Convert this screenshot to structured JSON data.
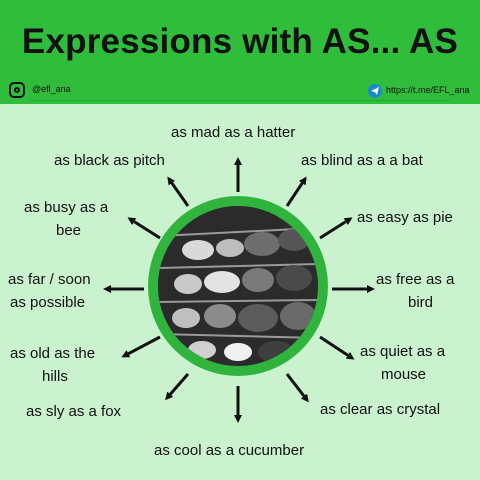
{
  "header": {
    "title": "Expressions with AS... AS",
    "instagram_handle": "@efl_ana",
    "telegram_link": "https://t.me/EFL_ana"
  },
  "phrases": {
    "mad": "as mad as a hatter",
    "black": "as black as pitch",
    "blind": "as blind as a a bat",
    "busy_1": "as busy as a",
    "busy_2": "bee",
    "easy": "as easy as pie",
    "far_1": "as far / soon",
    "far_2": "as possible",
    "free_1": "as free as a",
    "free_2": "bird",
    "old_1": "as old as the",
    "old_2": "hills",
    "quiet_1": "as quiet as a",
    "quiet_2": "mouse",
    "sly": "as sly as a fox",
    "clear": "as clear as crystal",
    "cool": "as cool as a cucumber"
  },
  "colors": {
    "header_green": "#2fbd3b",
    "background": "#cbf2cf",
    "ring_green": "#30b43d"
  },
  "icons": [
    "instagram-icon",
    "telegram-icon",
    "arrow-icon"
  ]
}
